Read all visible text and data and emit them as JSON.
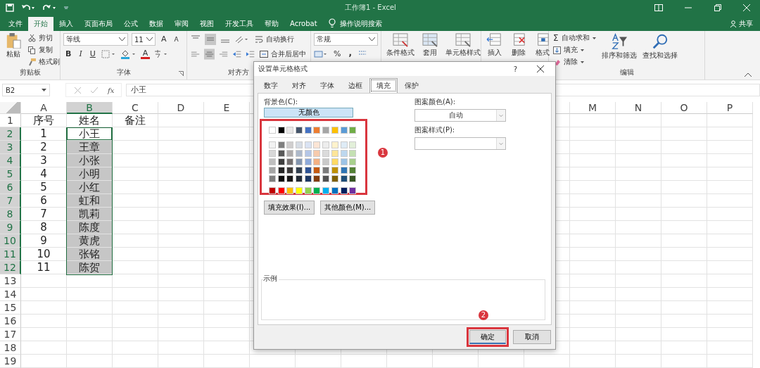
{
  "title_bar": {
    "title": "工作簿1 - Excel"
  },
  "menu": {
    "tabs": [
      {
        "label": "文件",
        "selected": false
      },
      {
        "label": "开始",
        "selected": true
      },
      {
        "label": "插入",
        "selected": false
      },
      {
        "label": "页面布局",
        "selected": false
      },
      {
        "label": "公式",
        "selected": false
      },
      {
        "label": "数据",
        "selected": false
      },
      {
        "label": "审阅",
        "selected": false
      },
      {
        "label": "视图",
        "selected": false
      },
      {
        "label": "开发工具",
        "selected": false
      },
      {
        "label": "帮助",
        "selected": false
      },
      {
        "label": "Acrobat",
        "selected": false
      }
    ],
    "tell_me": "操作说明搜索",
    "share": "共享"
  },
  "ribbon": {
    "clipboard": {
      "paste": "粘贴",
      "items": [
        "剪切",
        "复制",
        "格式刷"
      ],
      "label": "剪贴板"
    },
    "font": {
      "name": "等线",
      "size": "11",
      "grow": "A",
      "shrink": "A",
      "styles": [
        "B",
        "I",
        "U"
      ],
      "color_glyph": "A",
      "label": "字体"
    },
    "alignment": {
      "wrap": "自动换行",
      "merge": "合并后居中",
      "label": "对齐方"
    },
    "number": {
      "format": "常规",
      "symbols": [
        "%",
        ","
      ]
    },
    "styles": [
      "条件格式",
      "套用",
      "单元格样式"
    ],
    "cells": [
      "插入",
      "删除",
      "格式"
    ],
    "editing": {
      "sum_symbol": "Σ",
      "items": [
        "自动求和",
        "填充",
        "清除"
      ],
      "buttons": [
        "排序和筛选",
        "查找和选择"
      ],
      "label": "编辑"
    }
  },
  "formula_bar": {
    "name_box": "B2",
    "fx": "fx",
    "value": "小王"
  },
  "sheet": {
    "columns": [
      {
        "label": "A",
        "selected": false
      },
      {
        "label": "B",
        "selected": true
      },
      {
        "label": "C",
        "selected": false
      },
      {
        "label": "D",
        "selected": false
      },
      {
        "label": "E",
        "selected": false
      },
      {
        "label": "M",
        "selected": false
      },
      {
        "label": "N",
        "selected": false
      },
      {
        "label": "O",
        "selected": false
      },
      {
        "label": "P",
        "selected": false
      }
    ],
    "rows": [
      {
        "header": "1",
        "selected": false,
        "active": false,
        "cells": [
          "序号",
          "姓名",
          "备注"
        ]
      },
      {
        "header": "2",
        "selected": true,
        "active": true,
        "cells": [
          "1",
          "小王"
        ]
      },
      {
        "header": "3",
        "selected": true,
        "active": false,
        "cells": [
          "2",
          "王章"
        ]
      },
      {
        "header": "4",
        "selected": true,
        "active": false,
        "cells": [
          "3",
          "小张"
        ]
      },
      {
        "header": "5",
        "selected": true,
        "active": false,
        "cells": [
          "4",
          "小明"
        ]
      },
      {
        "header": "6",
        "selected": true,
        "active": false,
        "cells": [
          "5",
          "小红"
        ]
      },
      {
        "header": "7",
        "selected": true,
        "active": false,
        "cells": [
          "6",
          "虹和"
        ]
      },
      {
        "header": "8",
        "selected": true,
        "active": false,
        "cells": [
          "7",
          "凯莉"
        ]
      },
      {
        "header": "9",
        "selected": true,
        "active": false,
        "cells": [
          "8",
          "陈度"
        ]
      },
      {
        "header": "10",
        "selected": true,
        "active": false,
        "cells": [
          "9",
          "黄虎"
        ]
      },
      {
        "header": "11",
        "selected": true,
        "active": false,
        "cells": [
          "10",
          "张铭"
        ]
      },
      {
        "header": "12",
        "selected": true,
        "active": false,
        "cells": [
          "11",
          "陈贺"
        ]
      },
      {
        "header": "13",
        "selected": false,
        "active": false,
        "cells": []
      },
      {
        "header": "14",
        "selected": false,
        "active": false,
        "cells": []
      },
      {
        "header": "15",
        "selected": false,
        "active": false,
        "cells": []
      },
      {
        "header": "16",
        "selected": false,
        "active": false,
        "cells": []
      },
      {
        "header": "17",
        "selected": false,
        "active": false,
        "cells": []
      },
      {
        "header": "18",
        "selected": false,
        "active": false,
        "cells": []
      },
      {
        "header": "19",
        "selected": false,
        "active": false,
        "cells": []
      }
    ]
  },
  "dialog": {
    "title": "设置单元格格式",
    "help": "?",
    "tabs": [
      {
        "label": "数字",
        "selected": false
      },
      {
        "label": "对齐",
        "selected": false
      },
      {
        "label": "字体",
        "selected": false
      },
      {
        "label": "边框",
        "selected": false
      },
      {
        "label": "填充",
        "selected": true
      },
      {
        "label": "保护",
        "selected": false
      }
    ],
    "background_label": "背景色(C):",
    "no_color": "无颜色",
    "theme_colors": [
      {
        "color": "#ffffff"
      },
      {
        "color": "#000000"
      },
      {
        "color": "#e7e6e6"
      },
      {
        "color": "#44546a"
      },
      {
        "color": "#4472c4"
      },
      {
        "color": "#ed7d31"
      },
      {
        "color": "#a5a5a5"
      },
      {
        "color": "#ffc000"
      },
      {
        "color": "#5b9bd5"
      },
      {
        "color": "#70ad47"
      }
    ],
    "shade_rows": [
      [
        {
          "color": "#f2f2f2"
        },
        {
          "color": "#7f7f7f"
        },
        {
          "color": "#d0cece"
        },
        {
          "color": "#d6dce4"
        },
        {
          "color": "#d9e2f3"
        },
        {
          "color": "#fbe5d5"
        },
        {
          "color": "#ededed"
        },
        {
          "color": "#fff2cc"
        },
        {
          "color": "#deebf6"
        },
        {
          "color": "#e2efd9"
        }
      ],
      [
        {
          "color": "#d8d8d8"
        },
        {
          "color": "#595959"
        },
        {
          "color": "#aeabab"
        },
        {
          "color": "#adb9ca"
        },
        {
          "color": "#b4c6e7"
        },
        {
          "color": "#f7cbac"
        },
        {
          "color": "#dbdbdb"
        },
        {
          "color": "#fee599"
        },
        {
          "color": "#bdd7ee"
        },
        {
          "color": "#c5e0b3"
        }
      ],
      [
        {
          "color": "#bfbfbf"
        },
        {
          "color": "#3f3f3f"
        },
        {
          "color": "#757070"
        },
        {
          "color": "#8496b0"
        },
        {
          "color": "#8eaadb"
        },
        {
          "color": "#f4b183"
        },
        {
          "color": "#c9c9c9"
        },
        {
          "color": "#ffd965"
        },
        {
          "color": "#9cc3e5"
        },
        {
          "color": "#a8d08d"
        }
      ],
      [
        {
          "color": "#a5a5a5"
        },
        {
          "color": "#262626"
        },
        {
          "color": "#3a3838"
        },
        {
          "color": "#323f4f"
        },
        {
          "color": "#2f5496"
        },
        {
          "color": "#c55a11"
        },
        {
          "color": "#7b7b7b"
        },
        {
          "color": "#bf9000"
        },
        {
          "color": "#2e75b5"
        },
        {
          "color": "#538135"
        }
      ],
      [
        {
          "color": "#7f7f7f"
        },
        {
          "color": "#0c0c0c"
        },
        {
          "color": "#171616"
        },
        {
          "color": "#222a35"
        },
        {
          "color": "#1e3864"
        },
        {
          "color": "#833c0b"
        },
        {
          "color": "#525252"
        },
        {
          "color": "#7f6000"
        },
        {
          "color": "#1e4e79"
        },
        {
          "color": "#375623"
        }
      ]
    ],
    "standard_colors": [
      {
        "color": "#c00000"
      },
      {
        "color": "#ff0000"
      },
      {
        "color": "#ffc000"
      },
      {
        "color": "#ffff00"
      },
      {
        "color": "#92d050"
      },
      {
        "color": "#00b050"
      },
      {
        "color": "#00b0f0"
      },
      {
        "color": "#0070c0"
      },
      {
        "color": "#002060"
      },
      {
        "color": "#7030a0"
      }
    ],
    "effect_buttons": [
      "填充效果(I)...",
      "其他颜色(M)..."
    ],
    "pattern_color_label": "图案颜色(A):",
    "pattern_color": "自动",
    "pattern_style_label": "图案样式(P):",
    "sample_label": "示例",
    "ok": "确定",
    "cancel": "取消"
  },
  "annotations": [
    {
      "label": "1"
    },
    {
      "label": "2"
    }
  ]
}
